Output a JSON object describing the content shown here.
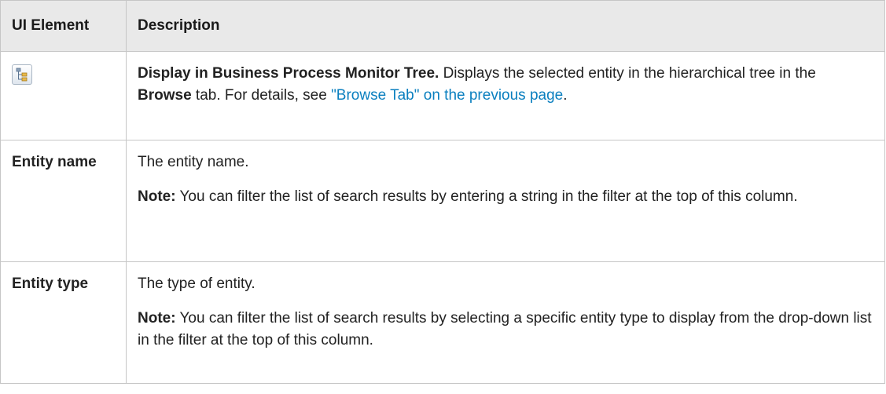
{
  "header": {
    "col_element": "UI Element",
    "col_description": "Description"
  },
  "rows": [
    {
      "element_icon": "tree-view-icon",
      "desc": {
        "bold_title": "Display in Business Process Monitor Tree.",
        "text_1": " Displays the selected entity in the hierarchical tree in the ",
        "bold_browse": "Browse",
        "text_2": " tab. For details, see ",
        "link": "\"Browse Tab\" on the previous page",
        "text_3": "."
      }
    },
    {
      "element": "Entity name",
      "desc_main": "The entity name.",
      "note_label": "Note:",
      "note_text": " You can filter the list of search results by entering a string in the filter at the top of this column."
    },
    {
      "element": "Entity type",
      "desc_main": "The type of entity.",
      "note_label": "Note:",
      "note_text": " You can filter the list of search results by selecting a specific entity type to display from the drop-down list in the filter at the top of this column."
    }
  ],
  "colors": {
    "header_bg": "#e9e9e9",
    "link": "#0a7fbf",
    "border": "#c6c6c6"
  }
}
